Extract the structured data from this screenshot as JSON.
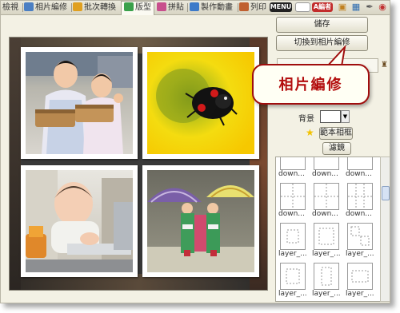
{
  "tabs": [
    {
      "label": "檢視",
      "icon": "view-icon"
    },
    {
      "label": "相片編修",
      "icon": "edit-photo-icon"
    },
    {
      "label": "批次轉換",
      "icon": "batch-convert-icon"
    },
    {
      "label": "版型",
      "icon": "layout-icon",
      "active": true
    },
    {
      "label": "拼貼",
      "icon": "collage-icon"
    },
    {
      "label": "製作動畫",
      "icon": "animation-icon"
    },
    {
      "label": "列印",
      "icon": "print-icon"
    }
  ],
  "toolbar": {
    "menu_label": "MENU",
    "tool_label": "A編者",
    "icons": [
      "folder-icon",
      "save-icon",
      "wrench-icon",
      "help-icon"
    ]
  },
  "panel": {
    "save_label": "儲存",
    "switch_label": "切換到相片編修",
    "background_label": "背景",
    "sample_label": "範本相框",
    "filter_label": "濾鏡"
  },
  "thumbnails": [
    "down...",
    "down...",
    "down...",
    "down...",
    "down...",
    "down...",
    "layer_...",
    "layer_...",
    "layer_...",
    "layer_...",
    "layer_...",
    "layer_..."
  ],
  "callout": {
    "text": "相片編修"
  },
  "colors": {
    "callout_border": "#a00d0d",
    "callout_text": "#b30d0d",
    "star": "#f2c200"
  }
}
